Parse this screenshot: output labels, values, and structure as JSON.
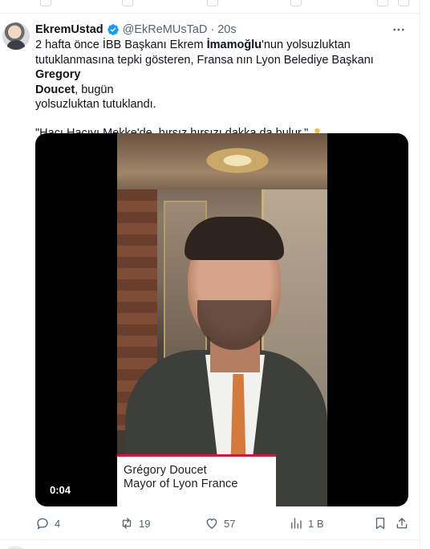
{
  "tweet": {
    "author_name": "EkremUstad",
    "handle": "@EkReMUsTaD",
    "separator": "·",
    "time": "20s",
    "text_line1_pre": "2 hafta önce İBB Başkanı Ekrem ",
    "text_line1_bold": "İmamoğlu",
    "text_line1_post": "'nun yolsuzluktan",
    "text_line2_pre": "tutuklanmasına tepki gösteren, Fransa nın Lyon Belediye Başkanı ",
    "text_line2_bold": "Gregory",
    "text_line3_bold": "Doucet",
    "text_line3_post": ", bugün",
    "text_line4": "yolsuzluktan tutuklandı.",
    "quote": "\"Hacı Hacıyı Mekke'de, hırsız hırsızı dakka da bulur.\""
  },
  "video": {
    "caption_name": "Grégory Doucet",
    "caption_title": "Mayor of Lyon France",
    "timestamp": "0:04"
  },
  "actions": {
    "reply_count": "4",
    "retweet_count": "19",
    "like_count": "57",
    "views_count": "1 B"
  },
  "colors": {
    "verified": "#1d9bf0",
    "muted": "#536471",
    "text": "#0f1419",
    "caption_accent": "#c81e3c"
  },
  "icons": [
    "verified-badge-icon",
    "more-icon",
    "shrug-emoji-icon",
    "reply-icon",
    "retweet-icon",
    "like-icon",
    "views-icon",
    "bookmark-icon",
    "share-icon"
  ]
}
